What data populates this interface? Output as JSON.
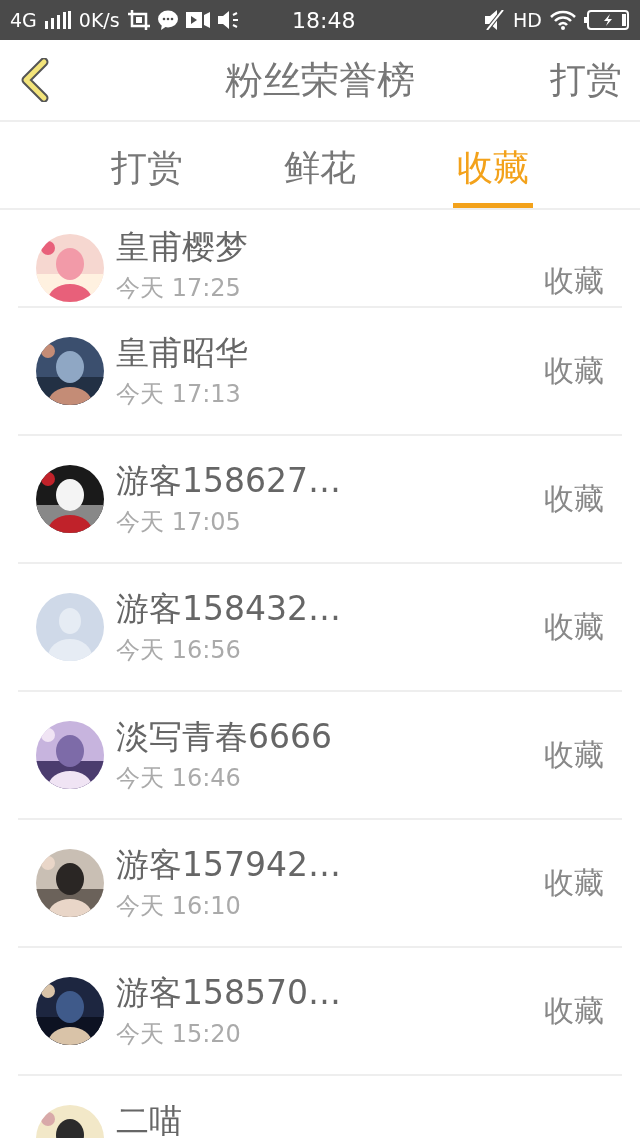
{
  "status_bar": {
    "network": "4G",
    "speed": "0K/s",
    "time": "18:48",
    "hd": "HD"
  },
  "header": {
    "title": "粉丝荣誉榜",
    "action": "打赏"
  },
  "tabs": [
    {
      "label": "打赏",
      "selected": false
    },
    {
      "label": "鲜花",
      "selected": false
    },
    {
      "label": "收藏",
      "selected": true
    }
  ],
  "fans": [
    {
      "name": "皇甫樱梦",
      "time": "今天 17:25",
      "action": "收藏"
    },
    {
      "name": "皇甫昭华",
      "time": "今天 17:13",
      "action": "收藏"
    },
    {
      "name": "游客158627…",
      "time": "今天 17:05",
      "action": "收藏"
    },
    {
      "name": "游客158432…",
      "time": "今天 16:56",
      "action": "收藏",
      "avatar": {
        "kind": "default"
      }
    },
    {
      "name": "淡写青春6666",
      "time": "今天 16:46",
      "action": "收藏"
    },
    {
      "name": "游客157942…",
      "time": "今天 16:10",
      "action": "收藏"
    },
    {
      "name": "游客158570…",
      "time": "今天 15:20",
      "action": "收藏"
    },
    {
      "name": "二喵"
    }
  ]
}
